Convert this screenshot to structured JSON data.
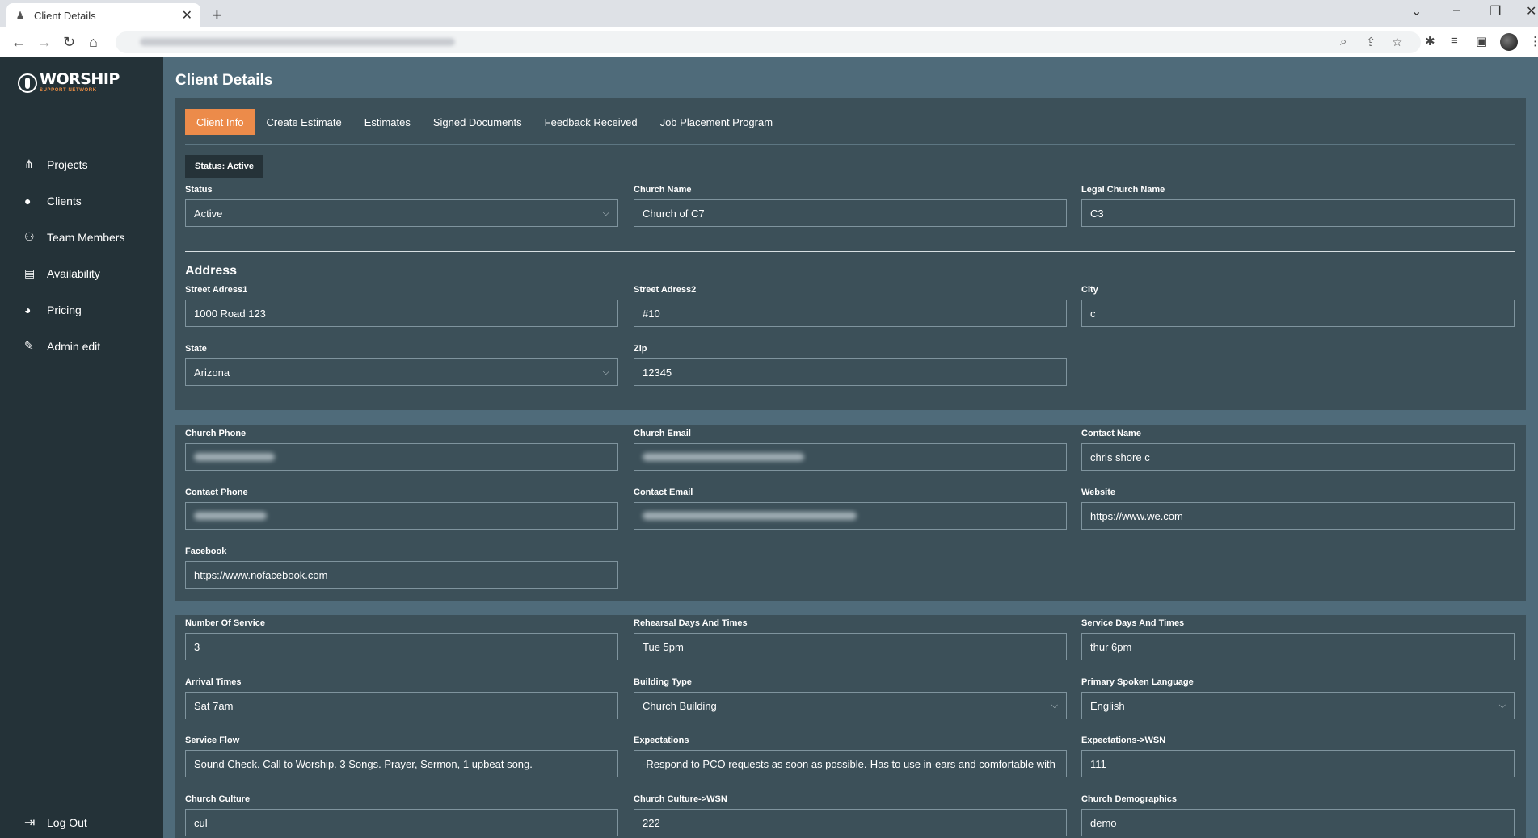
{
  "browser": {
    "tab_title": "Client Details"
  },
  "sidebar": {
    "logo_main": "WORSHIP",
    "logo_sub": "SUPPORT NETWORK",
    "items": [
      {
        "label": "Projects",
        "icon": "projects-icon"
      },
      {
        "label": "Clients",
        "icon": "user-icon"
      },
      {
        "label": "Team Members",
        "icon": "team-icon"
      },
      {
        "label": "Availability",
        "icon": "calendar-icon"
      },
      {
        "label": "Pricing",
        "icon": "pie-chart-icon"
      },
      {
        "label": "Admin edit",
        "icon": "edit-icon"
      }
    ],
    "logout": "Log Out"
  },
  "page": {
    "title": "Client Details",
    "tabs": [
      "Client Info",
      "Create Estimate",
      "Estimates",
      "Signed Documents",
      "Feedback Received",
      "Job Placement Program"
    ],
    "active_tab": "Client Info",
    "status_badge": "Status: Active",
    "address_heading": "Address"
  },
  "fields": {
    "status": {
      "label": "Status",
      "value": "Active"
    },
    "church_name": {
      "label": "Church Name",
      "value": "Church of C7"
    },
    "legal_church_name": {
      "label": "Legal Church Name",
      "value": "C3"
    },
    "street1": {
      "label": "Street Adress1",
      "value": "1000 Road 123"
    },
    "street2": {
      "label": "Street Adress2",
      "value": "#10"
    },
    "city": {
      "label": "City",
      "value": "c"
    },
    "state": {
      "label": "State",
      "value": "Arizona"
    },
    "zip": {
      "label": "Zip",
      "value": "12345"
    },
    "church_phone": {
      "label": "Church Phone"
    },
    "church_email": {
      "label": "Church Email"
    },
    "contact_name": {
      "label": "Contact Name",
      "value": "chris shore c"
    },
    "contact_phone": {
      "label": "Contact Phone"
    },
    "contact_email": {
      "label": "Contact Email"
    },
    "website": {
      "label": "Website",
      "value": "https://www.we.com"
    },
    "facebook": {
      "label": "Facebook",
      "value": "https://www.nofacebook.com"
    },
    "number_of_service": {
      "label": "Number Of Service",
      "value": "3"
    },
    "rehearsal": {
      "label": "Rehearsal Days And Times",
      "value": "Tue 5pm"
    },
    "service_days": {
      "label": "Service Days And Times",
      "value": "thur 6pm"
    },
    "arrival": {
      "label": "Arrival Times",
      "value": "Sat 7am"
    },
    "building_type": {
      "label": "Building Type",
      "value": "Church Building"
    },
    "language": {
      "label": "Primary Spoken Language",
      "value": "English"
    },
    "service_flow": {
      "label": "Service Flow",
      "value": "Sound Check. Call to Worship. 3 Songs. Prayer, Sermon, 1 upbeat song."
    },
    "expectations": {
      "label": "Expectations",
      "value": "-Respond to PCO requests as soon as possible.-Has to use in-ears and comfortable with clic"
    },
    "expectations_wsn": {
      "label": "Expectations->WSN",
      "value": "111"
    },
    "culture": {
      "label": "Church Culture",
      "value": "cul"
    },
    "culture_wsn": {
      "label": "Church Culture->WSN",
      "value": "222"
    },
    "demographics": {
      "label": "Church Demographics",
      "value": "demo"
    }
  }
}
